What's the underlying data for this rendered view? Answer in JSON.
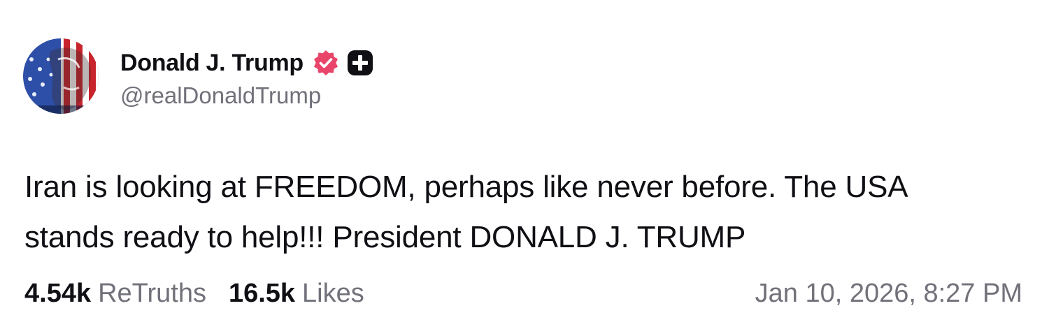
{
  "author": {
    "display_name": "Donald J. Trump",
    "handle": "@realDonaldTrump",
    "verified_badge_icon": "verified-badge-icon",
    "extra_badge_icon": "plus-badge-icon",
    "verified_color": "#e9456b"
  },
  "post": {
    "line1": "Iran is looking at FREEDOM, perhaps like never before. The USA",
    "line2": "stands ready to help!!! President DONALD J. TRUMP"
  },
  "stats": {
    "retruths_count": "4.54k",
    "retruths_label": "ReTruths",
    "likes_count": "16.5k",
    "likes_label": "Likes"
  },
  "timestamp": "Jan 10, 2026, 8:27 PM",
  "colors": {
    "text": "#0f0f14",
    "muted": "#71717a",
    "background": "#ffffff"
  }
}
